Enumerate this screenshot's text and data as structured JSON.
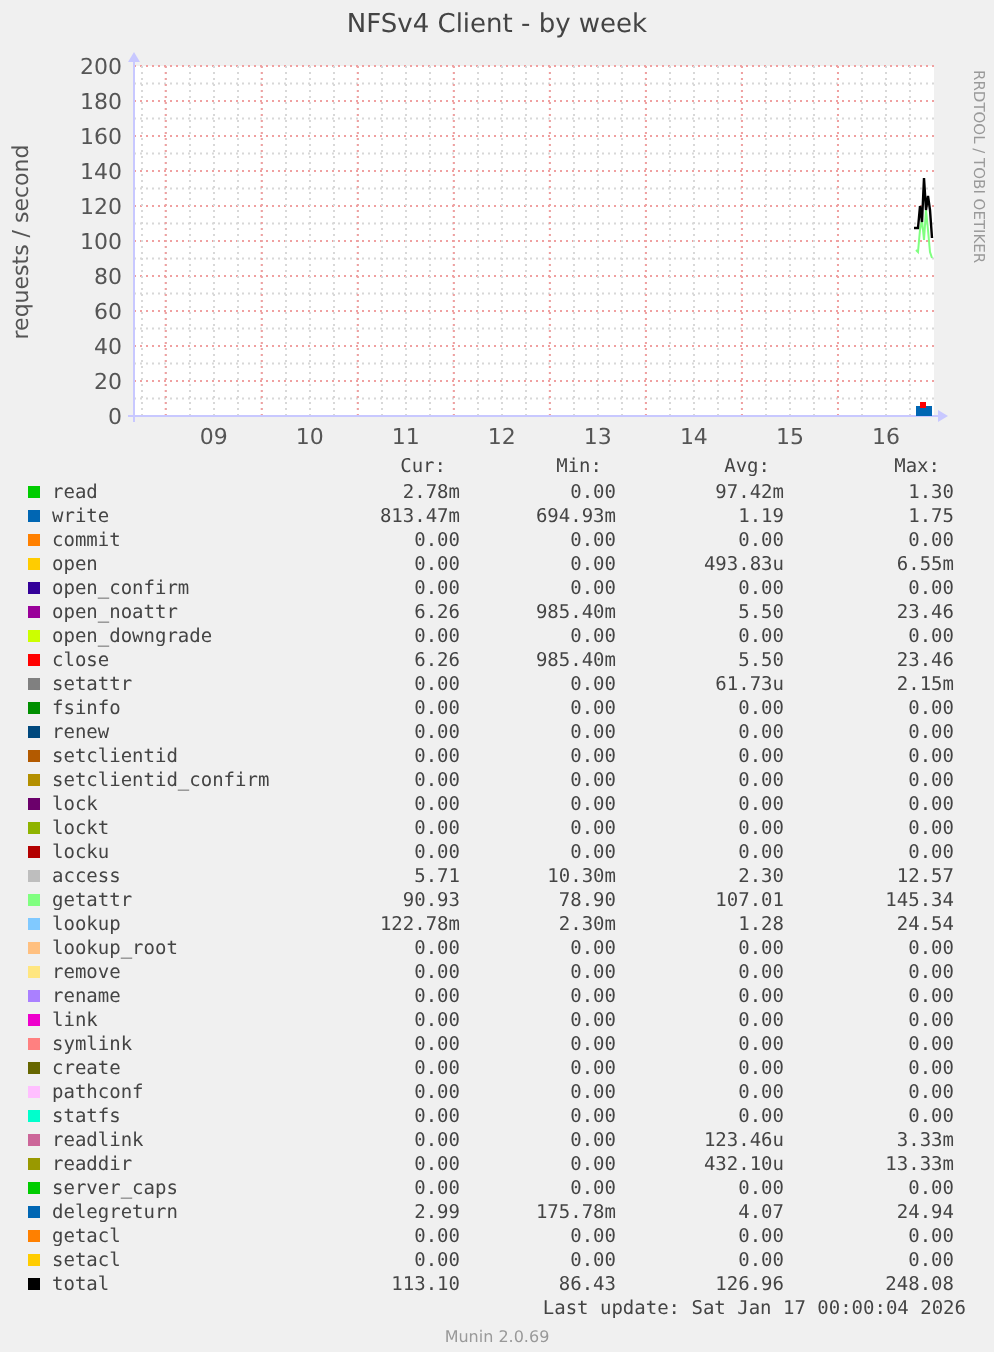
{
  "title": "NFSv4 Client - by week",
  "watermark_side": "RRDTOOL / TOBI OETIKER",
  "chart": {
    "chart_data": {
      "type": "line",
      "ylabel": "requests / second",
      "ylim": [
        0,
        200
      ],
      "yticks": [
        0,
        20,
        40,
        60,
        80,
        100,
        120,
        140,
        160,
        180,
        200
      ],
      "xlim": [
        8.17,
        16.5
      ],
      "grid": true,
      "xticks": [
        {
          "value": 9,
          "label": "09"
        },
        {
          "value": 10,
          "label": "10"
        },
        {
          "value": 11,
          "label": "11"
        },
        {
          "value": 12,
          "label": "12"
        },
        {
          "value": 13,
          "label": "13"
        },
        {
          "value": 14,
          "label": "14"
        },
        {
          "value": 15,
          "label": "15"
        },
        {
          "value": 16,
          "label": "16"
        }
      ]
    }
  },
  "legend": {
    "columns": [
      "Cur:",
      "Min:",
      "Avg:",
      "Max:"
    ],
    "rows": [
      {
        "name": "read",
        "color": "#00cc00",
        "cur": "2.78m",
        "min": "0.00",
        "avg": "97.42m",
        "max": "1.30"
      },
      {
        "name": "write",
        "color": "#0066b3",
        "cur": "813.47m",
        "min": "694.93m",
        "avg": "1.19",
        "max": "1.75"
      },
      {
        "name": "commit",
        "color": "#ff8000",
        "cur": "0.00",
        "min": "0.00",
        "avg": "0.00",
        "max": "0.00"
      },
      {
        "name": "open",
        "color": "#ffcc00",
        "cur": "0.00",
        "min": "0.00",
        "avg": "493.83u",
        "max": "6.55m"
      },
      {
        "name": "open_confirm",
        "color": "#330099",
        "cur": "0.00",
        "min": "0.00",
        "avg": "0.00",
        "max": "0.00"
      },
      {
        "name": "open_noattr",
        "color": "#990099",
        "cur": "6.26",
        "min": "985.40m",
        "avg": "5.50",
        "max": "23.46"
      },
      {
        "name": "open_downgrade",
        "color": "#ccff00",
        "cur": "0.00",
        "min": "0.00",
        "avg": "0.00",
        "max": "0.00"
      },
      {
        "name": "close",
        "color": "#ff0000",
        "cur": "6.26",
        "min": "985.40m",
        "avg": "5.50",
        "max": "23.46"
      },
      {
        "name": "setattr",
        "color": "#808080",
        "cur": "0.00",
        "min": "0.00",
        "avg": "61.73u",
        "max": "2.15m"
      },
      {
        "name": "fsinfo",
        "color": "#008f00",
        "cur": "0.00",
        "min": "0.00",
        "avg": "0.00",
        "max": "0.00"
      },
      {
        "name": "renew",
        "color": "#00487d",
        "cur": "0.00",
        "min": "0.00",
        "avg": "0.00",
        "max": "0.00"
      },
      {
        "name": "setclientid",
        "color": "#b35a00",
        "cur": "0.00",
        "min": "0.00",
        "avg": "0.00",
        "max": "0.00"
      },
      {
        "name": "setclientid_confirm",
        "color": "#b38f00",
        "cur": "0.00",
        "min": "0.00",
        "avg": "0.00",
        "max": "0.00"
      },
      {
        "name": "lock",
        "color": "#6b006b",
        "cur": "0.00",
        "min": "0.00",
        "avg": "0.00",
        "max": "0.00"
      },
      {
        "name": "lockt",
        "color": "#8fb300",
        "cur": "0.00",
        "min": "0.00",
        "avg": "0.00",
        "max": "0.00"
      },
      {
        "name": "locku",
        "color": "#b30000",
        "cur": "0.00",
        "min": "0.00",
        "avg": "0.00",
        "max": "0.00"
      },
      {
        "name": "access",
        "color": "#bebebe",
        "cur": "5.71",
        "min": "10.30m",
        "avg": "2.30",
        "max": "12.57"
      },
      {
        "name": "getattr",
        "color": "#80ff80",
        "cur": "90.93",
        "min": "78.90",
        "avg": "107.01",
        "max": "145.34"
      },
      {
        "name": "lookup",
        "color": "#80c9ff",
        "cur": "122.78m",
        "min": "2.30m",
        "avg": "1.28",
        "max": "24.54"
      },
      {
        "name": "lookup_root",
        "color": "#ffc080",
        "cur": "0.00",
        "min": "0.00",
        "avg": "0.00",
        "max": "0.00"
      },
      {
        "name": "remove",
        "color": "#ffe680",
        "cur": "0.00",
        "min": "0.00",
        "avg": "0.00",
        "max": "0.00"
      },
      {
        "name": "rename",
        "color": "#aa80ff",
        "cur": "0.00",
        "min": "0.00",
        "avg": "0.00",
        "max": "0.00"
      },
      {
        "name": "link",
        "color": "#ee00cc",
        "cur": "0.00",
        "min": "0.00",
        "avg": "0.00",
        "max": "0.00"
      },
      {
        "name": "symlink",
        "color": "#ff8080",
        "cur": "0.00",
        "min": "0.00",
        "avg": "0.00",
        "max": "0.00"
      },
      {
        "name": "create",
        "color": "#666600",
        "cur": "0.00",
        "min": "0.00",
        "avg": "0.00",
        "max": "0.00"
      },
      {
        "name": "pathconf",
        "color": "#ffbfff",
        "cur": "0.00",
        "min": "0.00",
        "avg": "0.00",
        "max": "0.00"
      },
      {
        "name": "statfs",
        "color": "#00ffcc",
        "cur": "0.00",
        "min": "0.00",
        "avg": "0.00",
        "max": "0.00"
      },
      {
        "name": "readlink",
        "color": "#cc6699",
        "cur": "0.00",
        "min": "0.00",
        "avg": "123.46u",
        "max": "3.33m"
      },
      {
        "name": "readdir",
        "color": "#999900",
        "cur": "0.00",
        "min": "0.00",
        "avg": "432.10u",
        "max": "13.33m"
      },
      {
        "name": "server_caps",
        "color": "#00cc00",
        "cur": "0.00",
        "min": "0.00",
        "avg": "0.00",
        "max": "0.00"
      },
      {
        "name": "delegreturn",
        "color": "#0066b3",
        "cur": "2.99",
        "min": "175.78m",
        "avg": "4.07",
        "max": "24.94"
      },
      {
        "name": "getacl",
        "color": "#ff8000",
        "cur": "0.00",
        "min": "0.00",
        "avg": "0.00",
        "max": "0.00"
      },
      {
        "name": "setacl",
        "color": "#ffcc00",
        "cur": "0.00",
        "min": "0.00",
        "avg": "0.00",
        "max": "0.00"
      },
      {
        "name": "total",
        "color": "#000000",
        "cur": "113.10",
        "min": "86.43",
        "avg": "126.96",
        "max": "248.08"
      }
    ]
  },
  "last_update": "Last update: Sat Jan 17 00:00:04 2026",
  "footer": "Munin 2.0.69"
}
